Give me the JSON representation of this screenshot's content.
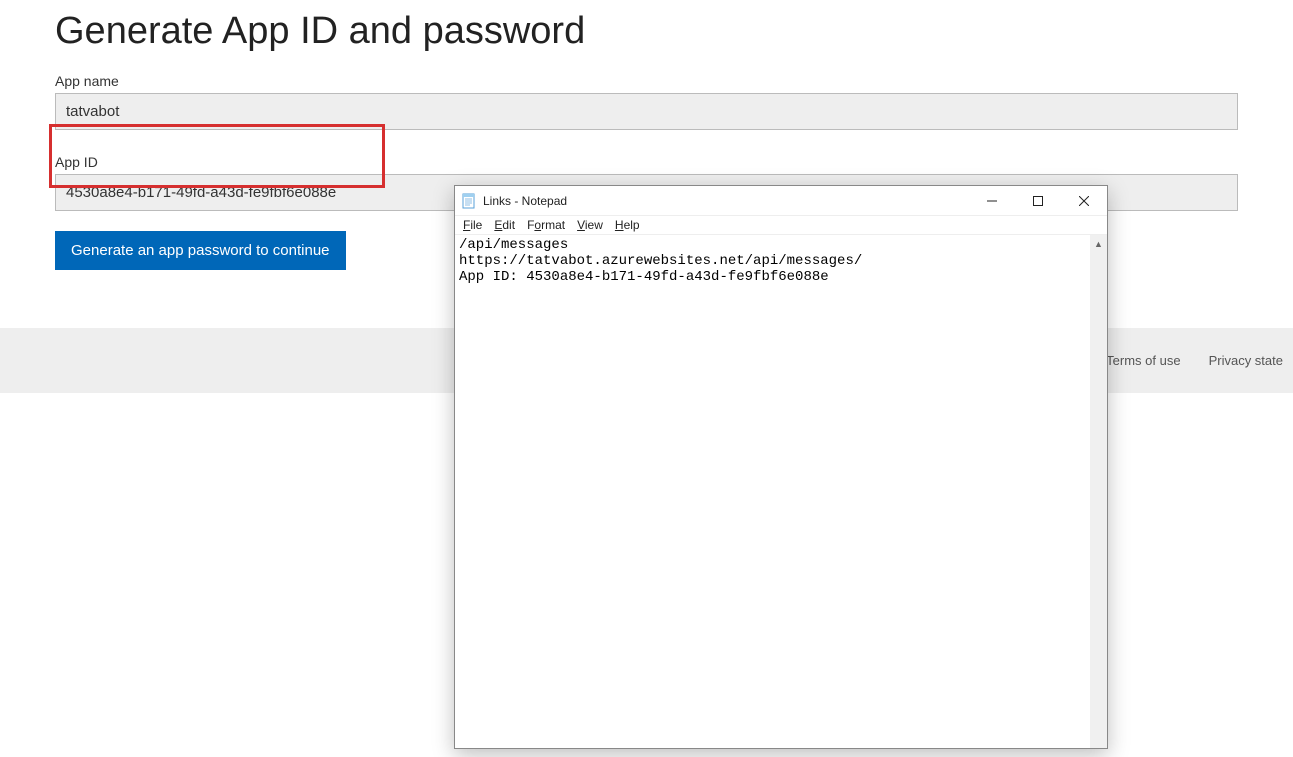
{
  "page": {
    "title": "Generate App ID and password",
    "app_name_label": "App name",
    "app_name_value": "tatvabot",
    "app_id_label": "App ID",
    "app_id_value": "4530a8e4-b171-49fd-a43d-fe9fbf6e088e",
    "generate_button": "Generate an app password to continue"
  },
  "footer": {
    "truncated_link": "s",
    "terms": "Terms of use",
    "privacy": "Privacy state"
  },
  "notepad": {
    "title": "Links - Notepad",
    "menu": {
      "file": "File",
      "edit": "Edit",
      "format": "Format",
      "view": "View",
      "help": "Help"
    },
    "content": "/api/messages\nhttps://tatvabot.azurewebsites.net/api/messages/\nApp ID: 4530a8e4-b171-49fd-a43d-fe9fbf6e088e"
  }
}
